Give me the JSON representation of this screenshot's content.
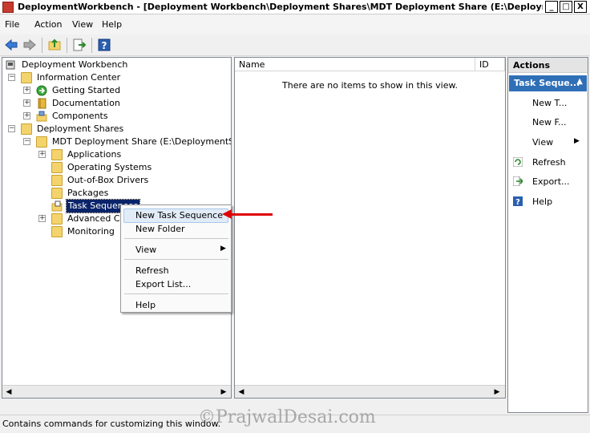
{
  "window": {
    "title": "DeploymentWorkbench - [Deployment Workbench\\Deployment Shares\\MDT Deployment Share (E:\\DeploymentSh...",
    "min_label": "_",
    "max_label": "□",
    "close_label": "X"
  },
  "menu": {
    "file": "File",
    "action": "Action",
    "view": "View",
    "help": "Help"
  },
  "tree": {
    "root": "Deployment Workbench",
    "info_center": "Information Center",
    "getting_started": "Getting Started",
    "documentation": "Documentation",
    "components": "Components",
    "deployment_shares": "Deployment Shares",
    "mdt_share": "MDT Deployment Share (E:\\DeploymentShare)",
    "applications": "Applications",
    "operating_systems": "Operating Systems",
    "drivers": "Out-of-Box Drivers",
    "packages": "Packages",
    "task_sequences": "Task Sequences",
    "advanced": "Advanced Con",
    "monitoring": "Monitoring",
    "expand_plus": "+",
    "expand_minus": "−"
  },
  "list": {
    "col_name": "Name",
    "col_id": "ID",
    "empty_text": "There are no items to show in this view."
  },
  "actions": {
    "header": "Actions",
    "section": "Task Seque...",
    "new_ts": "New T...",
    "new_folder": "New F...",
    "view": "View",
    "refresh": "Refresh",
    "export": "Export...",
    "help": "Help"
  },
  "context_menu": {
    "new_task_sequence": "New Task Sequence",
    "new_folder": "New Folder",
    "view": "View",
    "refresh": "Refresh",
    "export_list": "Export List...",
    "help": "Help"
  },
  "status": {
    "text": "Contains commands for customizing this window."
  },
  "watermark": "©PrajwalDesai.com",
  "colors": {
    "selection": "#0a246a",
    "action_section": "#2f6fb6",
    "annotation_arrow": "#e00000"
  }
}
